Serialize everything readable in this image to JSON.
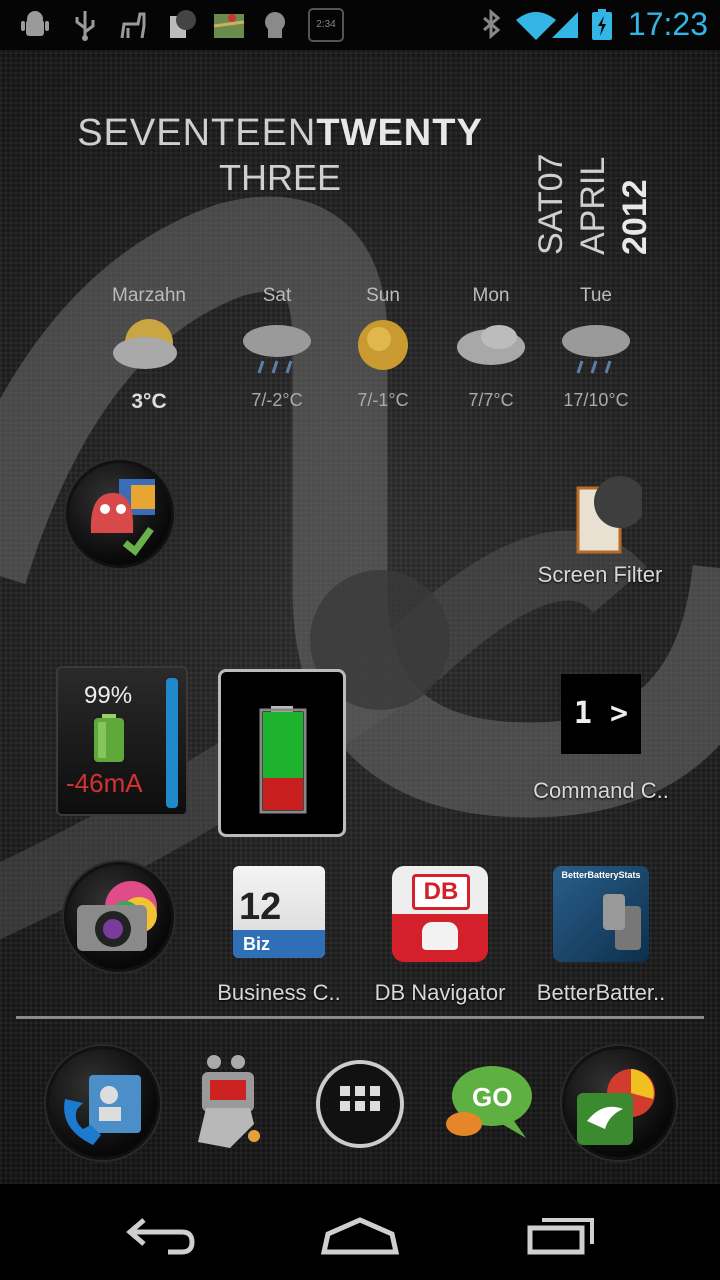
{
  "status_bar": {
    "left_icons": [
      "android-debug-icon",
      "usb-icon",
      "llama-icon",
      "screen-filter-icon",
      "maps-icon",
      "android-robot-icon",
      "clock-widget-icon"
    ],
    "right_icons": [
      "bluetooth-icon",
      "wifi-icon",
      "signal-icon",
      "battery-charging-icon"
    ],
    "time": "17:23",
    "accent_color": "#33b5e5",
    "mini_clock_text": "2:34"
  },
  "clock_widget": {
    "line1_normal": "SEVENTEEN",
    "line1_bold": "TWENTY",
    "line2": "THREE",
    "date_day": "SAT07",
    "date_month": "APRIL",
    "date_year": "2012"
  },
  "weather": [
    {
      "name": "Marzahn",
      "icon": "partly-cloudy-icon",
      "temp": "3°C"
    },
    {
      "name": "Sat",
      "icon": "rain-cloud-icon",
      "temp": "7/-2°C"
    },
    {
      "name": "Sun",
      "icon": "sunny-icon",
      "temp": "7/-1°C"
    },
    {
      "name": "Mon",
      "icon": "cloudy-icon",
      "temp": "7/7°C"
    },
    {
      "name": "Tue",
      "icon": "rain-cloud-icon",
      "temp": "17/10°C"
    }
  ],
  "apps": {
    "app_organizer": {
      "label": ""
    },
    "screen_filter": {
      "label": "Screen Filter"
    },
    "command_center": {
      "label": "Command C..",
      "icon_text": "1 >"
    },
    "camera": {
      "label": ""
    },
    "business_calendar": {
      "label": "Business C..",
      "icon_day": "12",
      "icon_sub": "Biz"
    },
    "db_navigator": {
      "label": "DB Navigator",
      "icon_text": "DB"
    },
    "better_battery": {
      "label": "BetterBatter..",
      "icon_title": "BetterBatteryStats"
    }
  },
  "battery_widget": {
    "percent": "99%",
    "current": "-46mA",
    "level": 0.99
  },
  "battery_widget2": {
    "level": 0.45
  },
  "dock": [
    "contacts-phone-icon",
    "sms-robot-icon",
    "app-drawer-icon",
    "go-sms-icon",
    "browser-icon"
  ],
  "nav": [
    "back-button",
    "home-button",
    "recent-apps-button"
  ]
}
